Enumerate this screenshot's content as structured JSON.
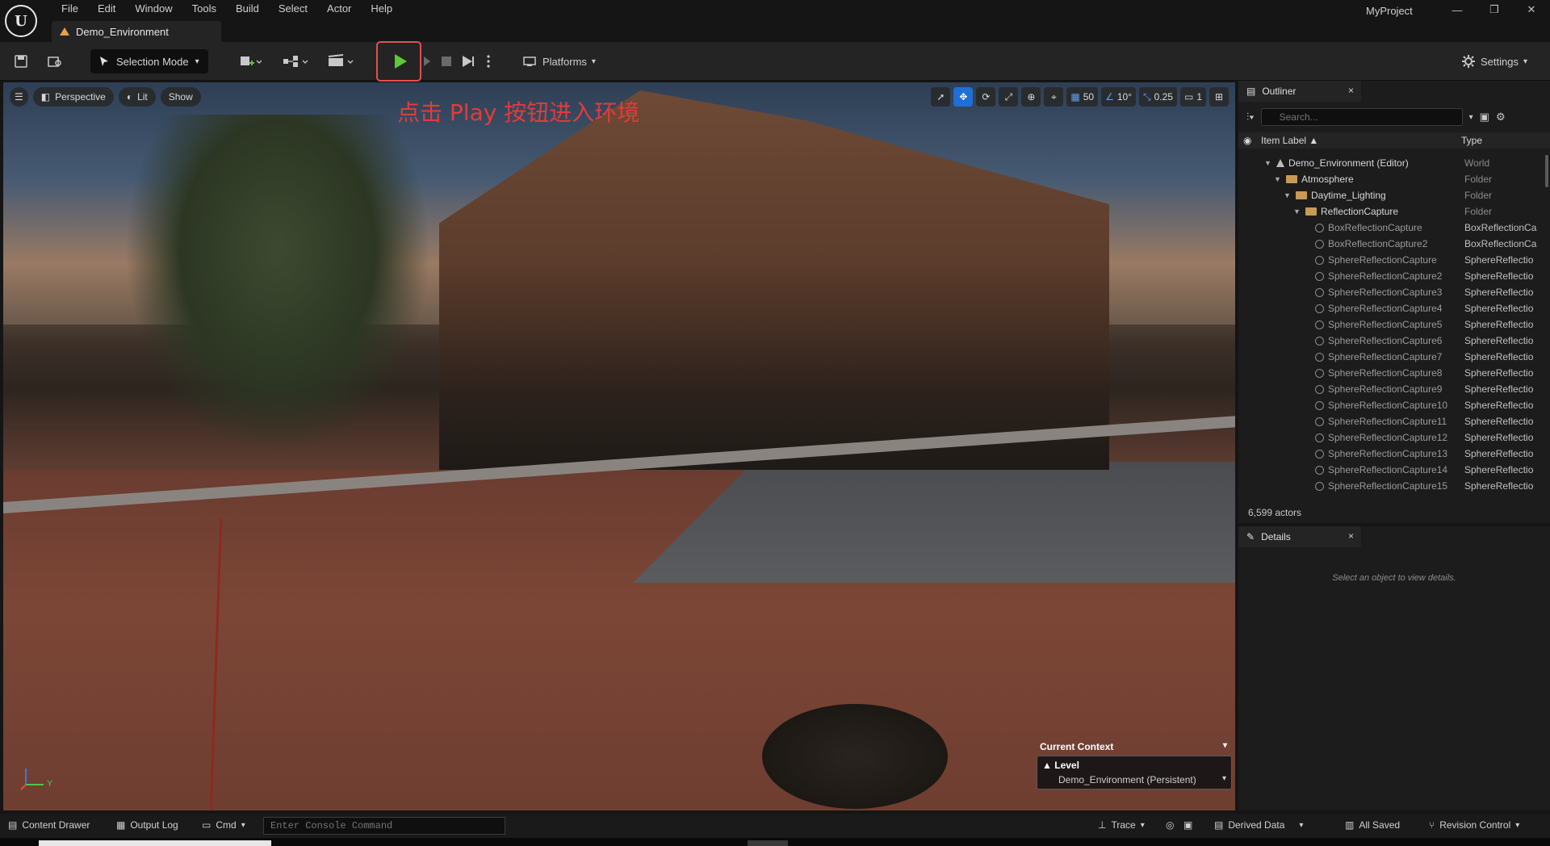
{
  "menubar": {
    "items": [
      "File",
      "Edit",
      "Window",
      "Tools",
      "Build",
      "Select",
      "Actor",
      "Help"
    ]
  },
  "document_tab": {
    "label": "Demo_Environment"
  },
  "project": {
    "name": "MyProject"
  },
  "window_controls": {
    "minimize": "—",
    "restore": "❐",
    "close": "✕"
  },
  "toolbar": {
    "selection_mode": "Selection Mode",
    "platforms": "Platforms",
    "settings": "Settings"
  },
  "viewport": {
    "menu_icon": "hamburger-icon",
    "perspective": "Perspective",
    "lit": "Lit",
    "show": "Show",
    "grid_snap": "50",
    "rotation_snap": "10°",
    "scale_snap": "0.25",
    "camera_speed": "1",
    "annotation": "点击 Play 按钮进入环境",
    "axis_label_y": "Y",
    "context": {
      "title": "Current Context",
      "level_label": "Level",
      "level_value": "Demo_Environment (Persistent)"
    }
  },
  "outliner": {
    "tab": "Outliner",
    "close": "×",
    "search_placeholder": "Search...",
    "header": {
      "label": "Item Label ▲",
      "type": "Type"
    },
    "rows": [
      {
        "label": "Demo_Environment (Editor)",
        "type": "World",
        "depth": 0,
        "kind": "world"
      },
      {
        "label": "Atmosphere",
        "type": "Folder",
        "depth": 1,
        "kind": "folder"
      },
      {
        "label": "Daytime_Lighting",
        "type": "Folder",
        "depth": 2,
        "kind": "folder"
      },
      {
        "label": "ReflectionCapture",
        "type": "Folder",
        "depth": 3,
        "kind": "folder"
      },
      {
        "label": "BoxReflectionCapture",
        "type": "BoxReflectionCa",
        "depth": 4,
        "kind": "actor"
      },
      {
        "label": "BoxReflectionCapture2",
        "type": "BoxReflectionCa",
        "depth": 4,
        "kind": "actor"
      },
      {
        "label": "SphereReflectionCapture",
        "type": "SphereReflectio",
        "depth": 4,
        "kind": "actor"
      },
      {
        "label": "SphereReflectionCapture2",
        "type": "SphereReflectio",
        "depth": 4,
        "kind": "actor"
      },
      {
        "label": "SphereReflectionCapture3",
        "type": "SphereReflectio",
        "depth": 4,
        "kind": "actor"
      },
      {
        "label": "SphereReflectionCapture4",
        "type": "SphereReflectio",
        "depth": 4,
        "kind": "actor"
      },
      {
        "label": "SphereReflectionCapture5",
        "type": "SphereReflectio",
        "depth": 4,
        "kind": "actor"
      },
      {
        "label": "SphereReflectionCapture6",
        "type": "SphereReflectio",
        "depth": 4,
        "kind": "actor"
      },
      {
        "label": "SphereReflectionCapture7",
        "type": "SphereReflectio",
        "depth": 4,
        "kind": "actor"
      },
      {
        "label": "SphereReflectionCapture8",
        "type": "SphereReflectio",
        "depth": 4,
        "kind": "actor"
      },
      {
        "label": "SphereReflectionCapture9",
        "type": "SphereReflectio",
        "depth": 4,
        "kind": "actor"
      },
      {
        "label": "SphereReflectionCapture10",
        "type": "SphereReflectio",
        "depth": 4,
        "kind": "actor"
      },
      {
        "label": "SphereReflectionCapture11",
        "type": "SphereReflectio",
        "depth": 4,
        "kind": "actor"
      },
      {
        "label": "SphereReflectionCapture12",
        "type": "SphereReflectio",
        "depth": 4,
        "kind": "actor"
      },
      {
        "label": "SphereReflectionCapture13",
        "type": "SphereReflectio",
        "depth": 4,
        "kind": "actor"
      },
      {
        "label": "SphereReflectionCapture14",
        "type": "SphereReflectio",
        "depth": 4,
        "kind": "actor"
      },
      {
        "label": "SphereReflectionCapture15",
        "type": "SphereReflectio",
        "depth": 4,
        "kind": "actor"
      }
    ],
    "actor_count": "6,599 actors"
  },
  "details": {
    "tab": "Details",
    "close": "×",
    "empty_message": "Select an object to view details."
  },
  "statusbar": {
    "content_drawer": "Content Drawer",
    "output_log": "Output Log",
    "cmd": "Cmd",
    "console_placeholder": "Enter Console Command",
    "trace": "Trace",
    "derived_data": "Derived Data",
    "all_saved": "All Saved",
    "revision_control": "Revision Control"
  },
  "colors": {
    "accent_blue": "#1f6fd6",
    "play_green": "#5cc83a",
    "annotation_red": "#e23b3b",
    "folder": "#c89a52"
  }
}
